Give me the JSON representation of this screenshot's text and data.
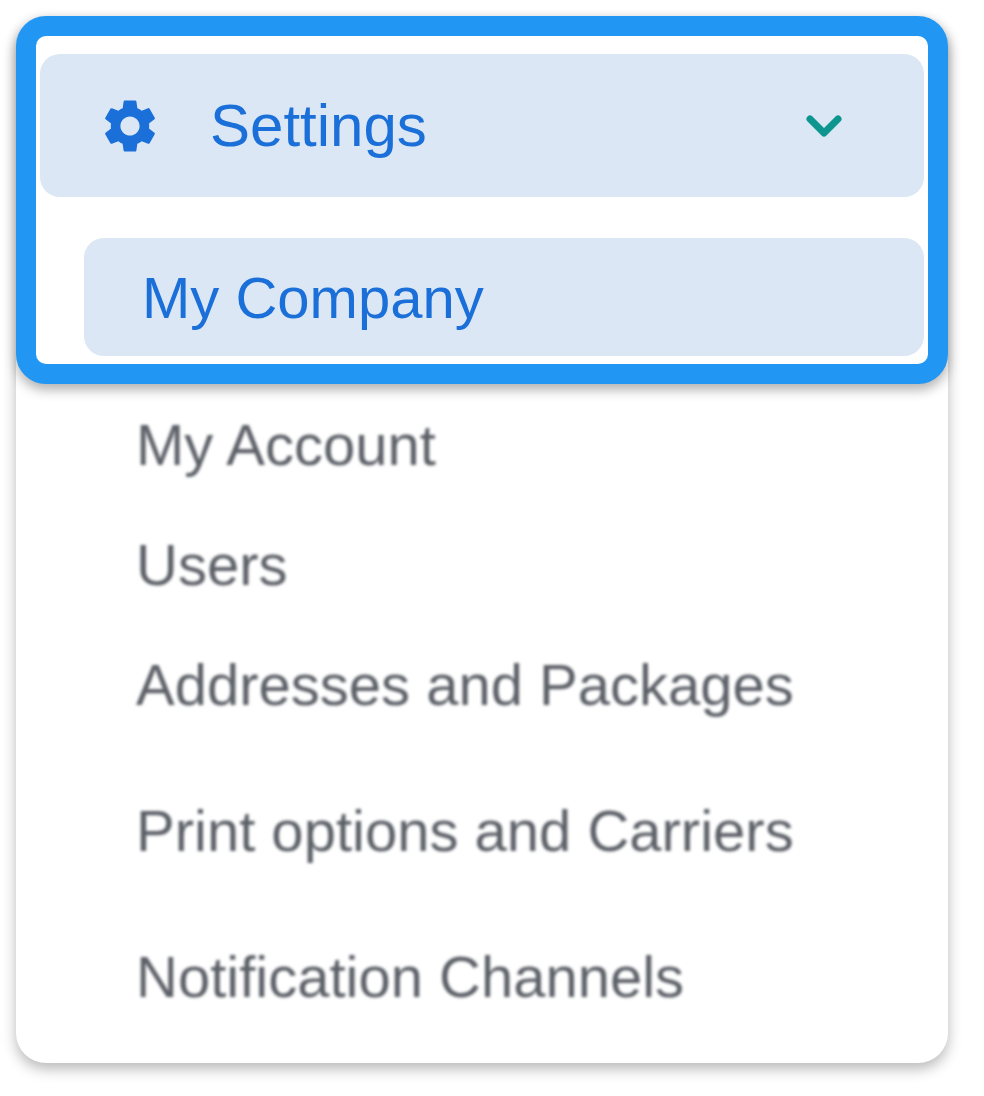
{
  "menu": {
    "header": {
      "label": "Settings",
      "expanded": true,
      "highlighted": true
    },
    "items": [
      {
        "label": "My Company",
        "selected": true,
        "highlighted": true
      },
      {
        "label": "My Account",
        "selected": false,
        "highlighted": false
      },
      {
        "label": "Users",
        "selected": false,
        "highlighted": false
      },
      {
        "label": "Addresses and Packages",
        "selected": false,
        "highlighted": false
      },
      {
        "label": "Print options and Carriers",
        "selected": false,
        "highlighted": false
      },
      {
        "label": "Notification Channels",
        "selected": false,
        "highlighted": false
      }
    ]
  }
}
